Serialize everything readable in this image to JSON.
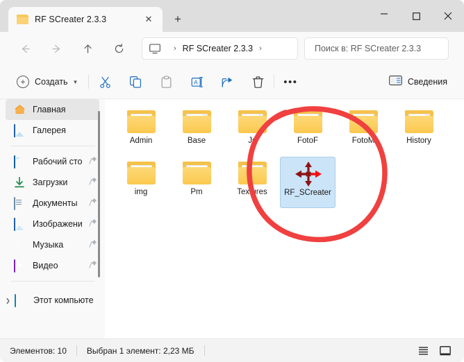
{
  "window": {
    "tab_title": "RF SCreater 2.3.3",
    "tab_close_label": "✕",
    "new_tab_label": "+",
    "minimize_label": "—",
    "maximize_label": "▢",
    "close_label": "✕"
  },
  "nav": {
    "back_label": "←",
    "forward_label": "→",
    "up_label": "↑",
    "refresh_label": "⟳",
    "breadcrumb_sep_1": "›",
    "breadcrumb_folder": "RF SCreater 2.3.3",
    "breadcrumb_sep_2": "›",
    "search_placeholder": "Поиск в: RF SCreater 2.3.3"
  },
  "toolbar": {
    "new_label": "Создать",
    "new_chevron": "⌄",
    "cut_name": "cut-icon",
    "copy_name": "copy-icon",
    "paste_name": "paste-icon",
    "rename_name": "rename-icon",
    "share_name": "share-icon",
    "delete_name": "delete-icon",
    "more_label": "•••",
    "details_label": "Сведения"
  },
  "sidebar": {
    "items": [
      {
        "label": "Главная",
        "icon": "home-icon",
        "selected": true,
        "pinned": false
      },
      {
        "label": "Галерея",
        "icon": "gallery-icon",
        "selected": false,
        "pinned": false
      },
      {
        "label": "Рабочий сто",
        "icon": "desktop-icon",
        "selected": false,
        "pinned": true
      },
      {
        "label": "Загрузки",
        "icon": "download-icon",
        "selected": false,
        "pinned": true
      },
      {
        "label": "Документы",
        "icon": "documents-icon",
        "selected": false,
        "pinned": true
      },
      {
        "label": "Изображени",
        "icon": "pictures-icon",
        "selected": false,
        "pinned": true
      },
      {
        "label": "Музыка",
        "icon": "music-icon",
        "selected": false,
        "pinned": true
      },
      {
        "label": "Видео",
        "icon": "video-icon",
        "selected": false,
        "pinned": true
      },
      {
        "label": "Этот компьюте",
        "icon": "pc-icon",
        "selected": false,
        "pinned": false
      }
    ]
  },
  "content": {
    "items": [
      {
        "name": "Admin",
        "type": "folder",
        "fill": "adm",
        "selected": false
      },
      {
        "name": "Base",
        "type": "folder",
        "fill": "doc",
        "selected": false
      },
      {
        "name": "Js",
        "type": "folder",
        "fill": "doc",
        "selected": false
      },
      {
        "name": "FotoF",
        "type": "folder",
        "fill": "dark",
        "selected": false
      },
      {
        "name": "FotoM",
        "type": "folder",
        "fill": "face",
        "selected": false
      },
      {
        "name": "History",
        "type": "folder",
        "fill": "doc",
        "selected": false
      },
      {
        "name": "img",
        "type": "folder",
        "fill": "sand",
        "selected": false
      },
      {
        "name": "Pm",
        "type": "folder",
        "fill": "text",
        "selected": false
      },
      {
        "name": "Textures",
        "type": "folder",
        "fill": "green",
        "selected": false
      },
      {
        "name": "RF_SCreater",
        "type": "app",
        "fill": "move",
        "selected": true
      }
    ]
  },
  "annotation": {
    "shape": "hand-drawn-circle",
    "color": "#f04040",
    "target": "RF_SCreater"
  },
  "statusbar": {
    "item_count": "Элементов: 10",
    "selection": "Выбран 1 элемент: 2,23 МБ",
    "list_view_name": "list-view-icon",
    "large_icons_view_name": "large-icons-view-icon"
  },
  "colors": {
    "accent": "#1b6ec2",
    "selection_bg": "#cce4f7",
    "folder": "#f5c24a",
    "annotation_red": "#f04040"
  }
}
